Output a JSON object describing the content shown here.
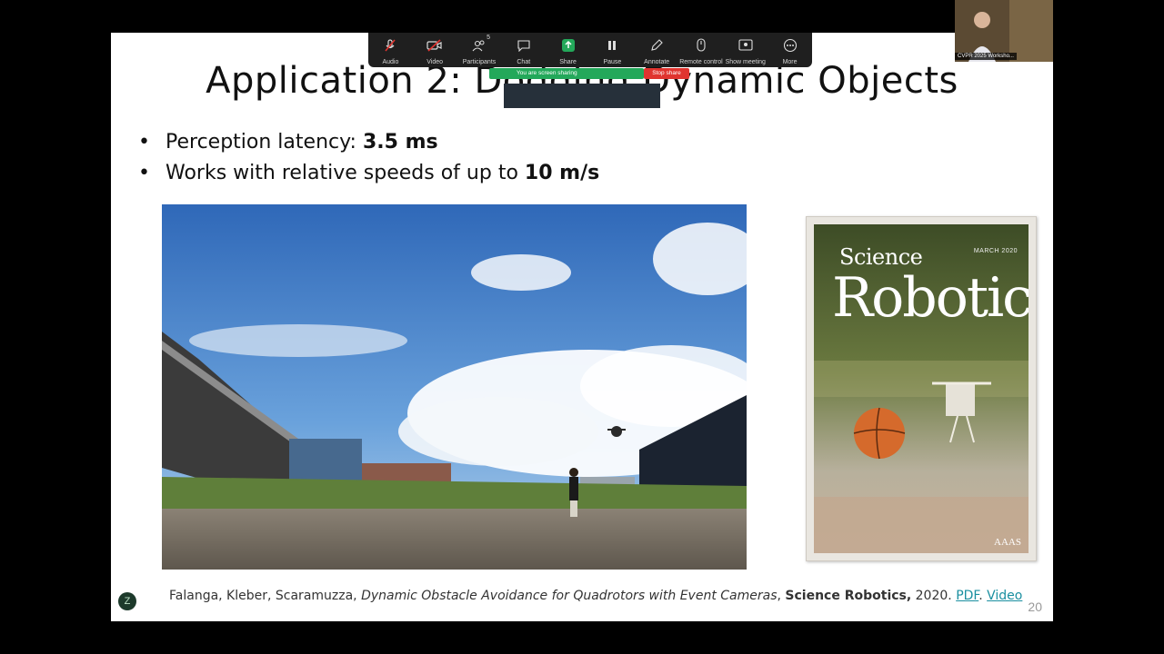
{
  "slide": {
    "title": "Application 2: Dodging Dynamic Objects",
    "bullets": [
      {
        "text": "Perception latency: ",
        "bold": "3.5 ms"
      },
      {
        "text": "Works with relative speeds of up to ",
        "bold": "10 m/s"
      }
    ],
    "cover": {
      "science": "Science",
      "robotics": "Robotics",
      "date": "MARCH 2020",
      "aaas": "AAAS"
    },
    "citation": {
      "authors": "Falanga, Kleber, Scaramuzza, ",
      "paper_title": "Dynamic Obstacle Avoidance for Quadrotors with Event Cameras",
      "separator": ", ",
      "journal": "Science Robotics,",
      "year": " 2020. ",
      "pdf_link": "PDF",
      "dot": ". ",
      "video_link": "Video"
    },
    "page_number": "20"
  },
  "toolbar": {
    "items": [
      {
        "label": "Audio",
        "icon": "mic-muted-icon"
      },
      {
        "label": "Video",
        "icon": "video-off-icon"
      },
      {
        "label": "Participants",
        "icon": "participants-icon",
        "count": "5"
      },
      {
        "label": "Chat",
        "icon": "chat-icon"
      },
      {
        "label": "Share",
        "icon": "share-icon"
      },
      {
        "label": "Pause",
        "icon": "pause-icon"
      },
      {
        "label": "Annotate",
        "icon": "annotate-icon"
      },
      {
        "label": "Remote control",
        "icon": "remote-control-icon"
      },
      {
        "label": "Show meeting",
        "icon": "show-meeting-icon"
      },
      {
        "label": "More",
        "icon": "more-icon"
      }
    ],
    "share_banner": "You are screen sharing",
    "stop_share": "Stop share"
  },
  "video_thumbnail": {
    "label": "CVPR 2025 Worksho..."
  },
  "colors": {
    "toolbar_bg": "#1f1f1f",
    "share_green": "#23a85a",
    "stop_red": "#e0342f",
    "link": "#1a8fa0"
  }
}
